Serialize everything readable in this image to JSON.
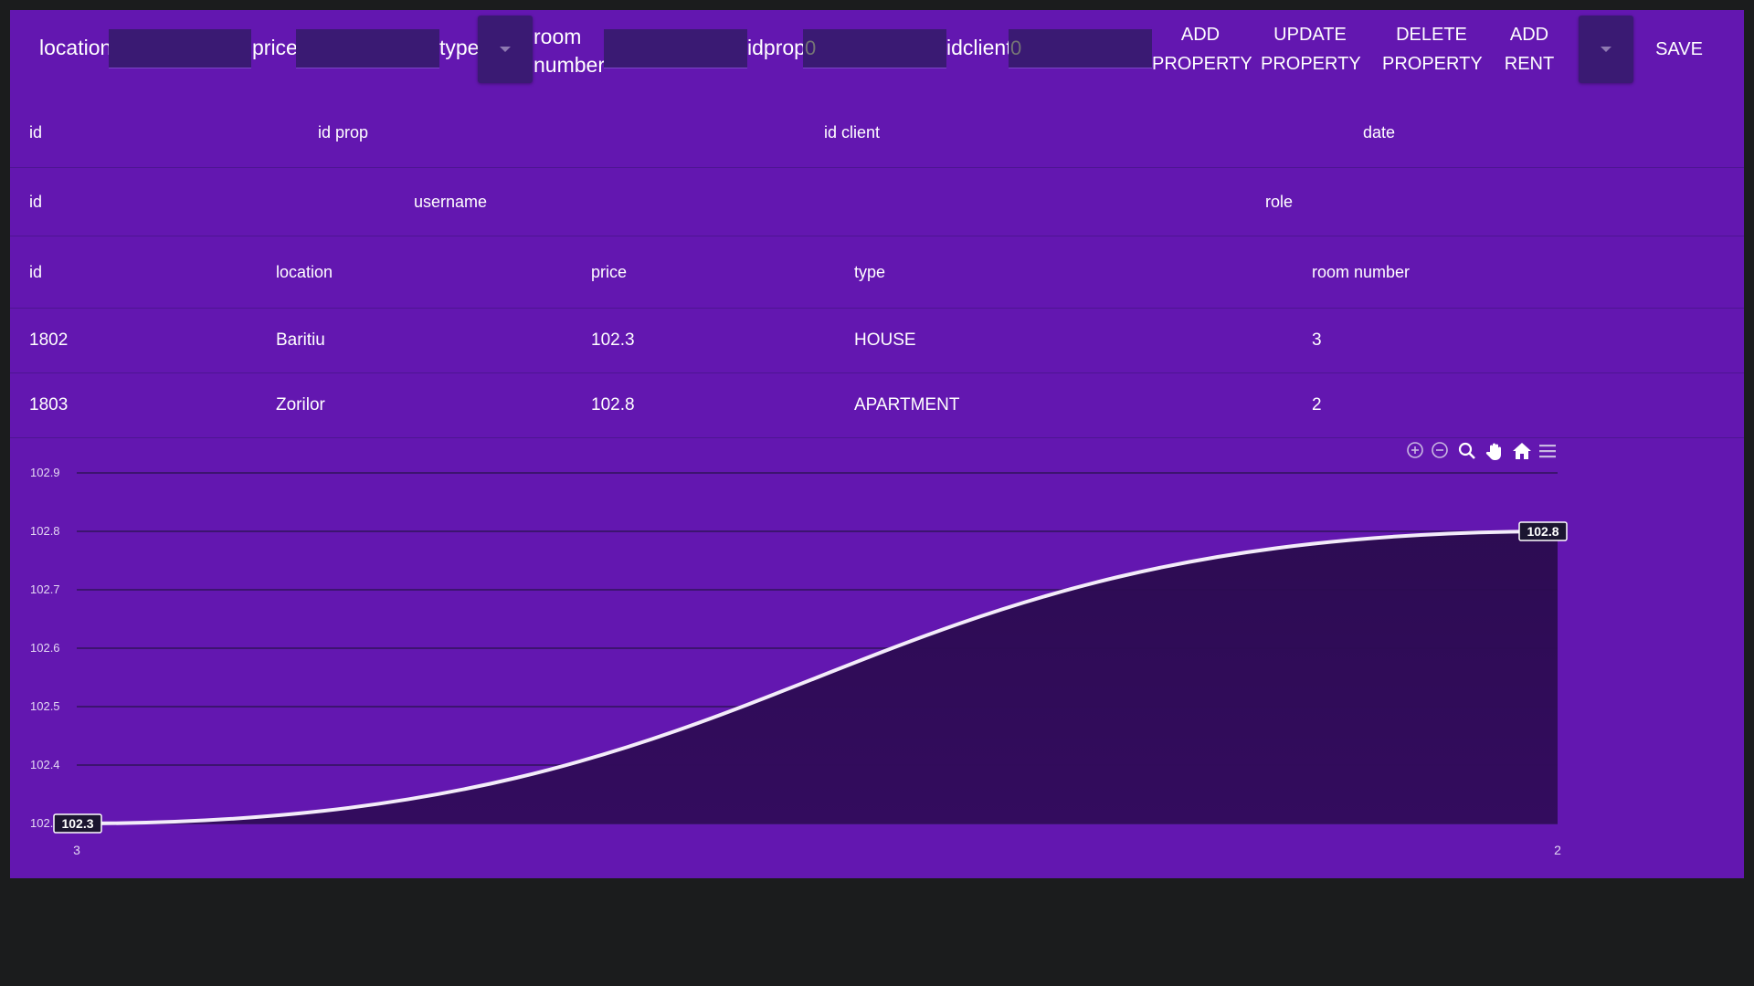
{
  "toolbar": {
    "location_label": "location",
    "price_label": "price",
    "type_label": "type",
    "room_number_label": "room number",
    "idprop_label": "idprop",
    "idprop_value": "0",
    "idclient_label": "idclient",
    "idclient_value": "0",
    "add_property": "ADD PROPERTY",
    "update_property": "UPDATE PROPERTY",
    "delete_property": "DELETE PROPERTY",
    "add_rent": "ADD RENT",
    "save": "SAVE"
  },
  "rent_table": {
    "headers": [
      "id",
      "id prop",
      "id client",
      "date"
    ]
  },
  "user_table": {
    "headers": [
      "id",
      "username",
      "role"
    ]
  },
  "property_table": {
    "headers": [
      "id",
      "location",
      "price",
      "type",
      "room number"
    ],
    "rows": [
      [
        "1802",
        "Baritiu",
        "102.3",
        "HOUSE",
        "3"
      ],
      [
        "1803",
        "Zorilor",
        "102.8",
        "APARTMENT",
        "2"
      ]
    ]
  },
  "chart_toolbar": [
    "zoom-in-icon",
    "zoom-out-icon",
    "selection-zoom-icon",
    "pan-icon",
    "reset-home-icon",
    "menu-icon"
  ],
  "colors": {
    "panel": "#6317b0",
    "input": "#3a1a73",
    "page": "#1b1c1d",
    "area": "#2d0e55"
  },
  "chart_data": {
    "type": "area",
    "categories": [
      "3",
      "2"
    ],
    "series": [
      {
        "values": [
          102.3,
          102.8
        ]
      }
    ],
    "data_labels": [
      "102.3",
      "102.8"
    ],
    "y_ticks": [
      "102.9",
      "102.8",
      "102.7",
      "102.6",
      "102.5",
      "102.4",
      "102.3"
    ],
    "ylim": [
      102.3,
      102.9
    ],
    "grid": true,
    "curve": "smooth"
  }
}
